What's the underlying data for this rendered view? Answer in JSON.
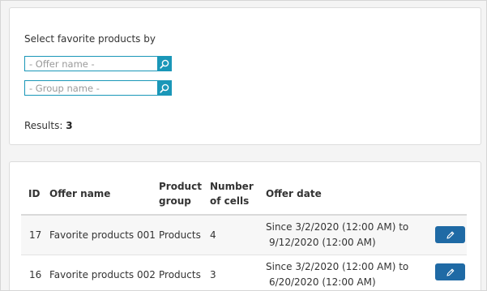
{
  "filter": {
    "title": "Select favorite products by",
    "offer_name_placeholder": "- Offer name -",
    "group_name_placeholder": "- Group name -",
    "results_label": "Results:",
    "results_count": "3"
  },
  "table": {
    "headers": {
      "id": "ID",
      "offer_name": "Offer name",
      "product_group_line1": "Product",
      "product_group_line2": "group",
      "cells_line1": "Number",
      "cells_line2": "of cells",
      "offer_date": "Offer date"
    },
    "rows": [
      {
        "id": "17",
        "offer_name": "Favorite products 001",
        "product_group": "Products",
        "cells": "4",
        "date_line1": "Since  3/2/2020 (12:00 AM) to",
        "date_line2": "9/12/2020 (12:00 AM)"
      },
      {
        "id": "16",
        "offer_name": "Favorite products 002",
        "product_group": "Products",
        "cells": "3",
        "date_line1": "Since  3/2/2020 (12:00 AM) to",
        "date_line2": "6/20/2020 (12:00 AM)"
      }
    ]
  },
  "colors": {
    "accent": "#1a97b8",
    "edit_button": "#1f6aa5"
  },
  "icons": {
    "search": "magnifier-icon",
    "edit": "pencil-icon"
  }
}
